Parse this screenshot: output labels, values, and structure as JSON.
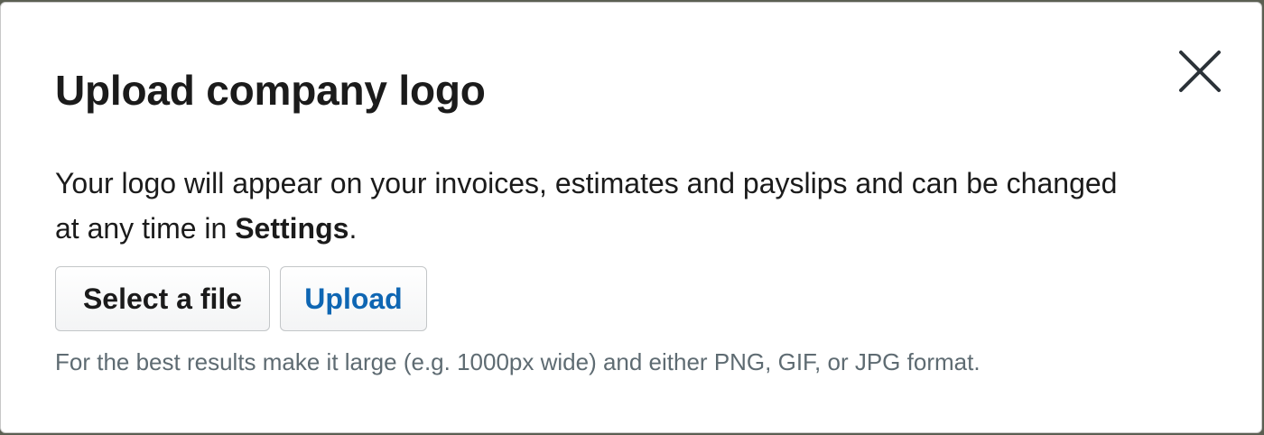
{
  "dialog": {
    "title": "Upload company logo",
    "description_before": "Your logo will appear on your invoices, estimates and payslips and can be changed at any time in ",
    "description_link": "Settings",
    "description_after": ".",
    "select_file_label": "Select a file",
    "upload_label": "Upload",
    "hint": "For the best results make it large (e.g. 1000px wide) and either PNG, GIF, or JPG format.",
    "close_icon": "close-icon"
  },
  "colors": {
    "text": "#1b1b1b",
    "upload_accent": "#0e66b3",
    "hint_text": "#5e6b72"
  }
}
